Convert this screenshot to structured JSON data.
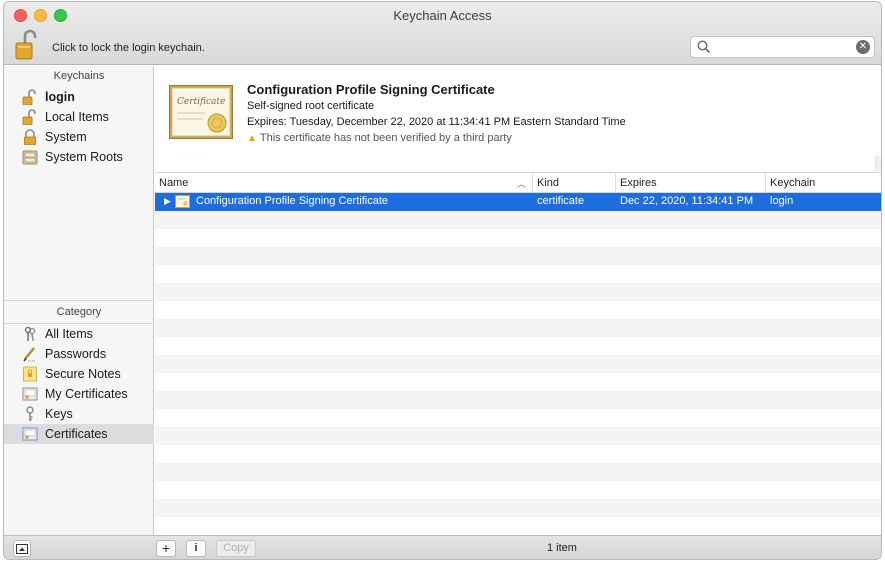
{
  "window": {
    "title": "Keychain Access"
  },
  "toolbar": {
    "lock_text": "Click to lock the login keychain.",
    "search_placeholder": ""
  },
  "sidebar": {
    "keychains_header": "Keychains",
    "keychains": [
      {
        "label": "login",
        "icon": "unlocked-padlock-icon"
      },
      {
        "label": "Local Items",
        "icon": "unlocked-padlock-icon"
      },
      {
        "label": "System",
        "icon": "locked-padlock-icon"
      },
      {
        "label": "System Roots",
        "icon": "cabinet-icon"
      }
    ],
    "category_header": "Category",
    "categories": [
      {
        "label": "All Items",
        "icon": "all-items-icon"
      },
      {
        "label": "Passwords",
        "icon": "pencil-icon"
      },
      {
        "label": "Secure Notes",
        "icon": "note-icon"
      },
      {
        "label": "My Certificates",
        "icon": "certificate-icon"
      },
      {
        "label": "Keys",
        "icon": "key-icon"
      },
      {
        "label": "Certificates",
        "icon": "certificate-icon"
      }
    ]
  },
  "info": {
    "title": "Configuration Profile Signing Certificate",
    "subtitle": "Self-signed root certificate",
    "expires": "Expires: Tuesday, December 22, 2020 at 11:34:41 PM Eastern Standard Time",
    "warning": "This certificate has not been verified by a third party"
  },
  "table": {
    "columns": {
      "name": "Name",
      "kind": "Kind",
      "expires": "Expires",
      "keychain": "Keychain"
    },
    "rows": [
      {
        "name": "Configuration Profile Signing Certificate",
        "kind": "certificate",
        "expires": "Dec 22, 2020, 11:34:41 PM",
        "keychain": "login"
      }
    ]
  },
  "bottombar": {
    "add": "+",
    "info": "i",
    "copy": "Copy",
    "count": "1 item"
  },
  "colors": {
    "selection": "#1d6ce0",
    "warning": "#e8a800"
  }
}
